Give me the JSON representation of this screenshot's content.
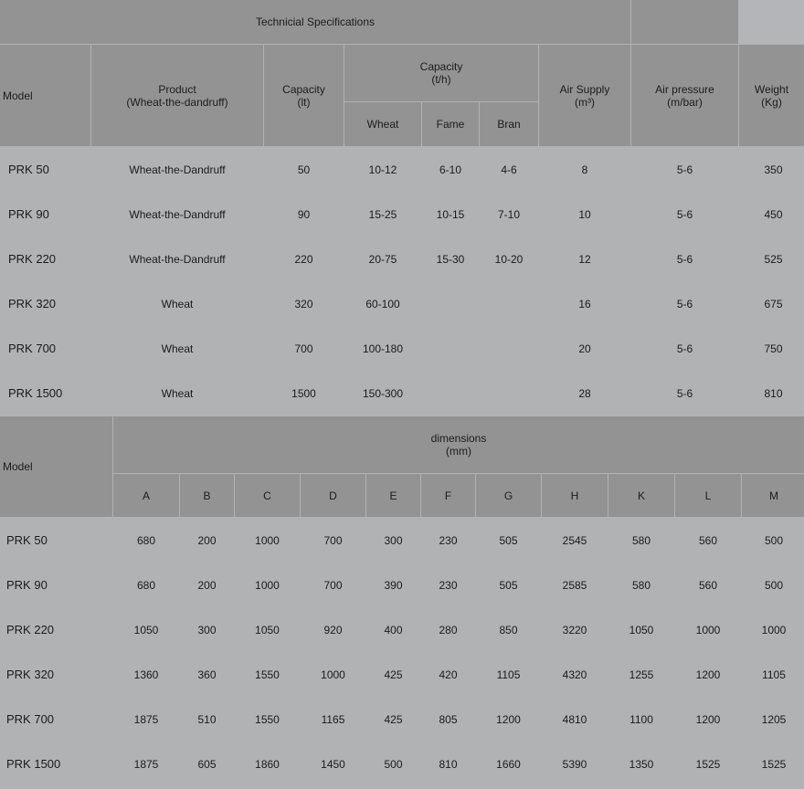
{
  "table1": {
    "title": "Technicial Specifications",
    "headers": {
      "model": "Model",
      "product": "Product\n(Wheat-the-dandruff)",
      "capacity_lt": "Capacity\n(lt)",
      "capacity_th": "Capacity\n(t/h)",
      "wheat": "Wheat",
      "fame": "Fame",
      "bran": "Bran",
      "air_supply": "Air Supply\n(m³)",
      "air_pressure": "Air pressure\n(m/bar)",
      "weight": "Weight\n(Kg)"
    },
    "rows": [
      [
        "PRK 50",
        "Wheat-the-Dandruff",
        "50",
        "10-12",
        "6-10",
        "4-6",
        "8",
        "5-6",
        "350"
      ],
      [
        "PRK 90",
        "Wheat-the-Dandruff",
        "90",
        "15-25",
        "10-15",
        "7-10",
        "10",
        "5-6",
        "450"
      ],
      [
        "PRK 220",
        "Wheat-the-Dandruff",
        "220",
        "20-75",
        "15-30",
        "10-20",
        "12",
        "5-6",
        "525"
      ],
      [
        "PRK 320",
        "Wheat",
        "320",
        "60-100",
        "",
        "",
        "16",
        "5-6",
        "675"
      ],
      [
        "PRK 700",
        "Wheat",
        "700",
        "100-180",
        "",
        "",
        "20",
        "5-6",
        "750"
      ],
      [
        "PRK 1500",
        "Wheat",
        "1500",
        "150-300",
        "",
        "",
        "28",
        "5-6",
        "810"
      ]
    ]
  },
  "table2": {
    "headers": {
      "model": "Model",
      "dimensions": "dimensions\n(mm)",
      "columns": [
        "A",
        "B",
        "C",
        "D",
        "E",
        "F",
        "G",
        "H",
        "K",
        "L",
        "M"
      ]
    },
    "rows": [
      [
        "PRK 50",
        "680",
        "200",
        "1000",
        "700",
        "300",
        "230",
        "505",
        "2545",
        "580",
        "560",
        "500"
      ],
      [
        "PRK 90",
        "680",
        "200",
        "1000",
        "700",
        "390",
        "230",
        "505",
        "2585",
        "580",
        "560",
        "500"
      ],
      [
        "PRK 220",
        "1050",
        "300",
        "1050",
        "920",
        "400",
        "280",
        "850",
        "3220",
        "1050",
        "1000",
        "1000"
      ],
      [
        "PRK 320",
        "1360",
        "360",
        "1550",
        "1000",
        "425",
        "420",
        "1105",
        "4320",
        "1255",
        "1200",
        "1105"
      ],
      [
        "PRK 700",
        "1875",
        "510",
        "1550",
        "1165",
        "425",
        "805",
        "1200",
        "4810",
        "1100",
        "1200",
        "1205"
      ],
      [
        "PRK 1500",
        "1875",
        "605",
        "1860",
        "1450",
        "500",
        "810",
        "1660",
        "5390",
        "1350",
        "1525",
        "1525"
      ]
    ]
  }
}
